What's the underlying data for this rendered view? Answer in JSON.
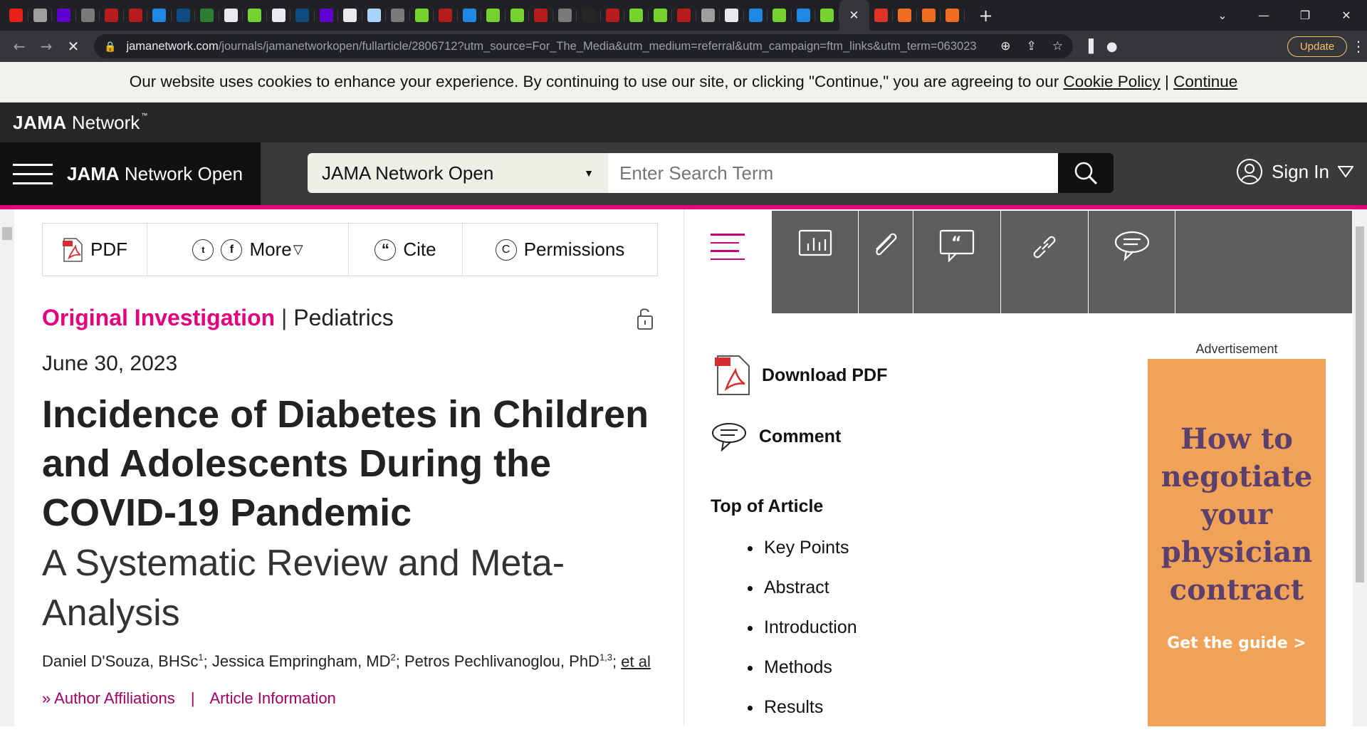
{
  "browser": {
    "tab_count": 39,
    "tab_colors": [
      "#e62117",
      "#9e9e9e",
      "#6001d2",
      "#7a7a7a",
      "#b81b1b",
      "#b81b1b",
      "#1e88e5",
      "#0f4c81",
      "#2e7d32",
      "#e8eaed",
      "#76d32e",
      "#e8eaed",
      "#0f4c81",
      "#6001d2",
      "#e8eaed",
      "#a8d4ff",
      "#7a7a7a",
      "#76d32e",
      "#b81b1b",
      "#1e88e5",
      "#76d32e",
      "#76d32e",
      "#b81b1b",
      "#7a7a7a",
      "#262626",
      "#b81b1b",
      "#76d32e",
      "#76d32e",
      "#b81b1b",
      "#9e9e9e",
      "#e8eaed",
      "#1e88e5",
      "#76d32e",
      "#1e88e5",
      "#76d32e",
      "#3a3a3a",
      "#e0342b",
      "#f26d21",
      "#f26d21",
      "#f26d21"
    ],
    "active_tab_close": "✕",
    "url_host": "jamanetwork.com",
    "url_path": "/journals/jamanetworkopen/fullarticle/2806712?utm_source=For_The_Media&utm_medium=referral&utm_campaign=ftm_links&utm_term=063023",
    "update_label": "Update"
  },
  "cookie_banner": {
    "text": "Our website uses cookies to enhance your experience. By continuing to use our site, or clicking \"Continue,\" you are agreeing to our",
    "policy_link": "Cookie Policy",
    "separator": "|",
    "continue_link": "Continue"
  },
  "header": {
    "brand_bold": "JAMA",
    "brand_rest": " Network",
    "brand_tm": "™",
    "journal_bold": "JAMA",
    "journal_rest": " Network Open",
    "search_scope": "JAMA Network Open",
    "search_placeholder": "Enter Search Term",
    "signin_label": "Sign In"
  },
  "toolbar": {
    "pdf_label": "PDF",
    "more_label": "More",
    "cite_label": "Cite",
    "permissions_label": "Permissions"
  },
  "article": {
    "category": "Original Investigation",
    "separator": "|",
    "subject": "Pediatrics",
    "date": "June 30, 2023",
    "title": "Incidence of Diabetes in Children and Adolescents During the COVID-19 Pandemic",
    "subtitle": "A Systematic Review and Meta-Analysis",
    "authors": [
      {
        "name": "Daniel D'Souza, BHSc",
        "sup": "1"
      },
      {
        "name": "Jessica Empringham, MD",
        "sup": "2"
      },
      {
        "name": "Petros Pechlivanoglou, PhD",
        "sup": "1,3"
      }
    ],
    "et_al": "et al",
    "author_affiliations": "Author Affiliations",
    "affil_separator": "|",
    "article_information": "Article Information"
  },
  "sidebar": {
    "download_pdf": "Download PDF",
    "comment": "Comment",
    "toc_title": "Top of Article",
    "toc_items": [
      "Key Points",
      "Abstract",
      "Introduction",
      "Methods",
      "Results"
    ]
  },
  "ad": {
    "label": "Advertisement",
    "headline": "How to negotiate your physician contract",
    "cta": "Get the guide >"
  },
  "colors": {
    "accent_pink": "#e4007c",
    "affil_link": "#a00064",
    "ad_bg": "#f0a356",
    "ad_text": "#5b3f6f"
  }
}
